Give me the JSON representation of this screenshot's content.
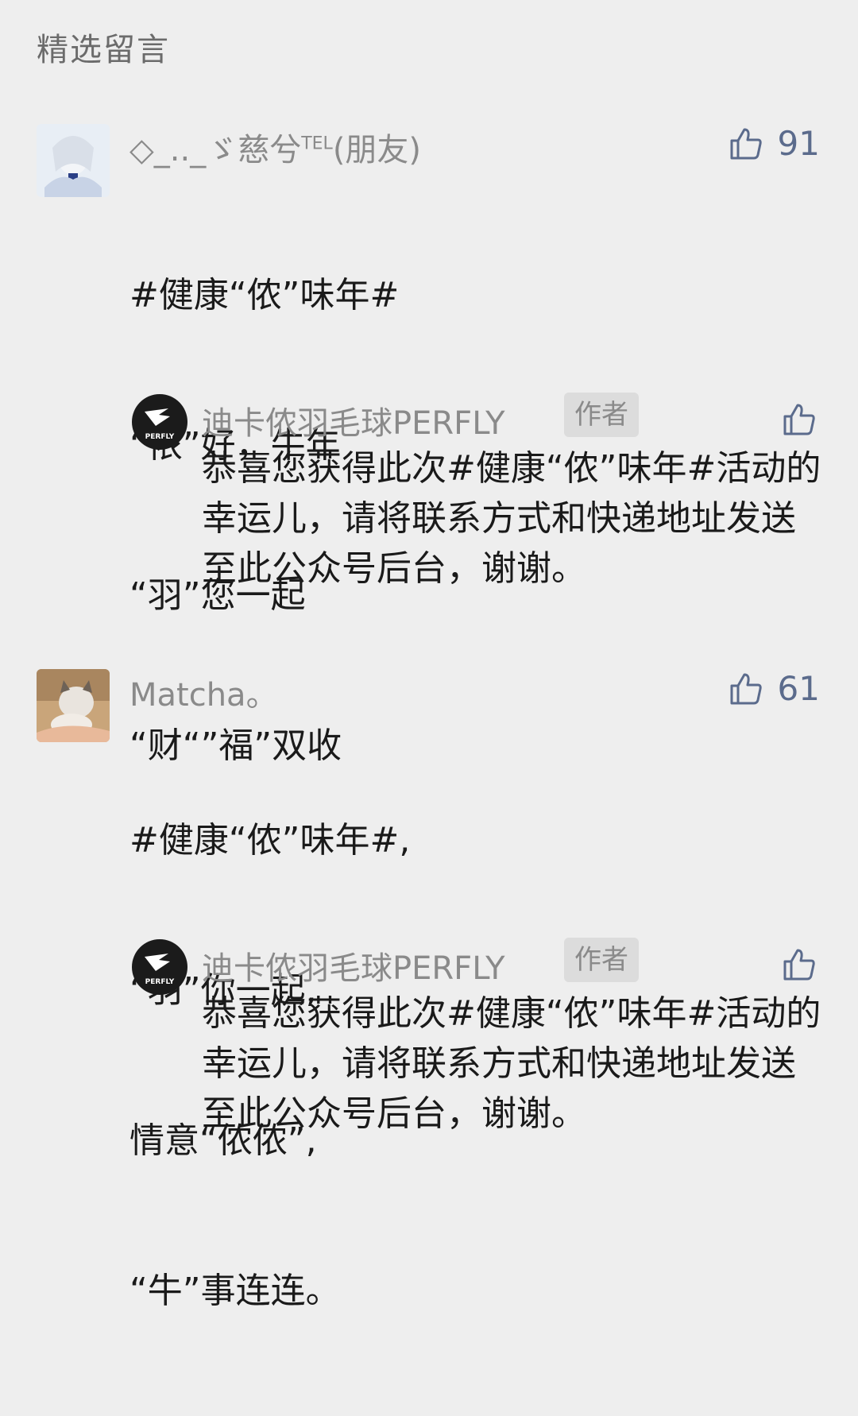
{
  "section_title": "精选留言",
  "comments": [
    {
      "nickname": "◇_.._ゞ慈兮",
      "nickname_sup": "TEL",
      "nickname_suffix": "(朋友)",
      "likes": "91",
      "lines": [
        "#健康“侬”味年#",
        "“侬”好，牛年",
        "“羽”您一起",
        "“财“”福”双收"
      ],
      "reply": {
        "author": "迪卡侬羽毛球PERFLY",
        "badge": "作者",
        "avatar_text": "PERFLY",
        "text": "恭喜您获得此次#健康“侬”味年#活动的幸运儿，请将联系方式和快递地址发送至此公众号后台，谢谢。"
      }
    },
    {
      "nickname": "Matcha。",
      "likes": "61",
      "lines": [
        "#健康“侬”味年#,",
        "“羽”你一起,",
        "情意“侬侬”,",
        "“牛”事连连。"
      ],
      "reply": {
        "author": "迪卡侬羽毛球PERFLY",
        "badge": "作者",
        "avatar_text": "PERFLY",
        "text": "恭喜您获得此次#健康“侬”味年#活动的幸运儿，请将联系方式和快递地址发送至此公众号后台，谢谢。"
      }
    }
  ],
  "colors": {
    "background": "#eeeeee",
    "like_accent": "#5b6b8c",
    "muted_text": "#8a8a8a"
  }
}
